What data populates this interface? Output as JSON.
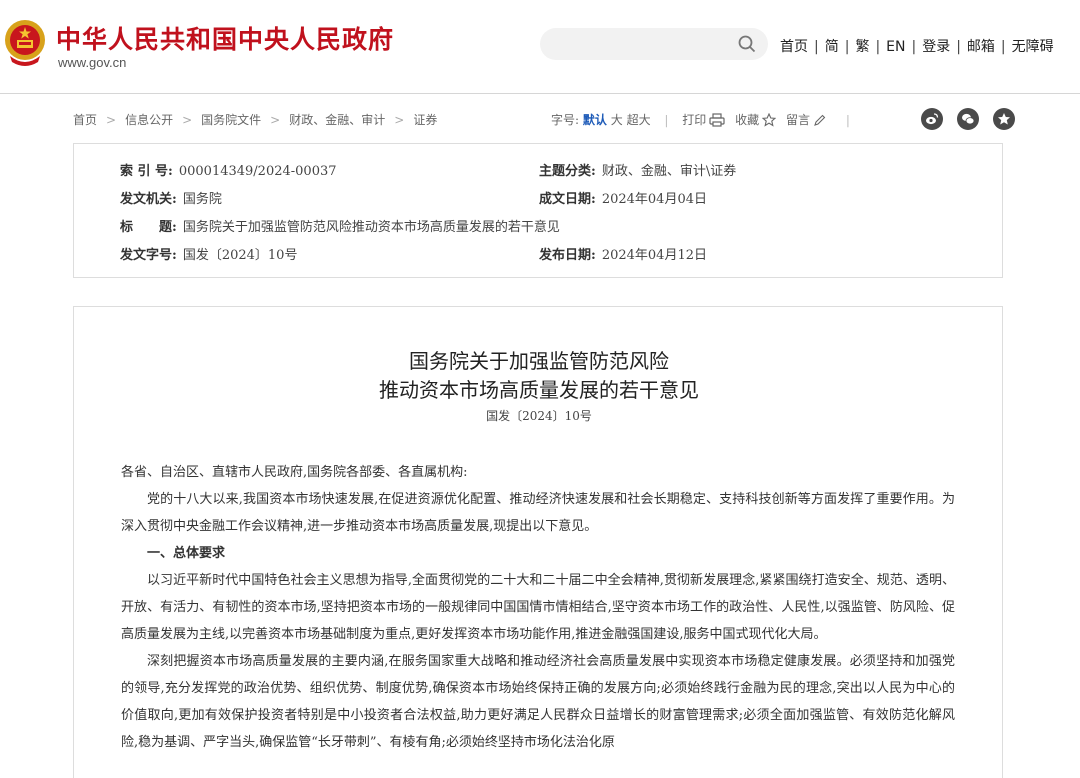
{
  "header": {
    "site_title": "中华人民共和国中央人民政府",
    "site_url": "www.gov.cn",
    "search_placeholder": "",
    "links": [
      "首页",
      "简",
      "繁",
      "EN",
      "登录",
      "邮箱",
      "无障碍"
    ],
    "separator": "|"
  },
  "breadcrumb": {
    "items": [
      "首页",
      "信息公开",
      "国务院文件",
      "财政、金融、审计",
      "证券"
    ],
    "arrow": ">"
  },
  "tools": {
    "font_label": "字号:",
    "font_default": "默认",
    "font_large": "大",
    "font_xlarge": "超大",
    "print": "打印",
    "favorite": "收藏",
    "comment": "留言"
  },
  "social": {
    "icons": [
      "weibo-icon",
      "wechat-icon",
      "favorite-star-icon"
    ]
  },
  "info": {
    "index_label": "索 引 号:",
    "index_value": "000014349/2024-00037",
    "category_label": "主题分类:",
    "category_value": "财政、金融、审计\\证券",
    "issuer_label": "发文机关:",
    "issuer_value": "国务院",
    "written_label": "成文日期:",
    "written_value": "2024年04月04日",
    "title_label": "标　　题:",
    "title_value": "国务院关于加强监管防范风险推动资本市场高质量发展的若干意见",
    "docno_label": "发文字号:",
    "docno_value": "国发〔2024〕10号",
    "publish_label": "发布日期:",
    "publish_value": "2024年04月12日"
  },
  "article": {
    "title_line1": "国务院关于加强监管防范风险",
    "title_line2": "推动资本市场高质量发展的若干意见",
    "doc_number": "国发〔2024〕10号",
    "salutation": "各省、自治区、直辖市人民政府,国务院各部委、各直属机构:",
    "para1": "党的十八大以来,我国资本市场快速发展,在促进资源优化配置、推动经济快速发展和社会长期稳定、支持科技创新等方面发挥了重要作用。为深入贯彻中央金融工作会议精神,进一步推动资本市场高质量发展,现提出以下意见。",
    "heading1": "一、总体要求",
    "para2": "以习近平新时代中国特色社会主义思想为指导,全面贯彻党的二十大和二十届二中全会精神,贯彻新发展理念,紧紧围绕打造安全、规范、透明、开放、有活力、有韧性的资本市场,坚持把资本市场的一般规律同中国国情市情相结合,坚守资本市场工作的政治性、人民性,以强监管、防风险、促高质量发展为主线,以完善资本市场基础制度为重点,更好发挥资本市场功能作用,推进金融强国建设,服务中国式现代化大局。",
    "para3": "深刻把握资本市场高质量发展的主要内涵,在服务国家重大战略和推动经济社会高质量发展中实现资本市场稳定健康发展。必须坚持和加强党的领导,充分发挥党的政治优势、组织优势、制度优势,确保资本市场始终保持正确的发展方向;必须始终践行金融为民的理念,突出以人民为中心的价值取向,更加有效保护投资者特别是中小投资者合法权益,助力更好满足人民群众日益增长的财富管理需求;必须全面加强监管、有效防范化解风险,稳为基调、严字当头,确保监管“长牙带刺”、有棱有角;必须始终坚持市场化法治化原"
  }
}
